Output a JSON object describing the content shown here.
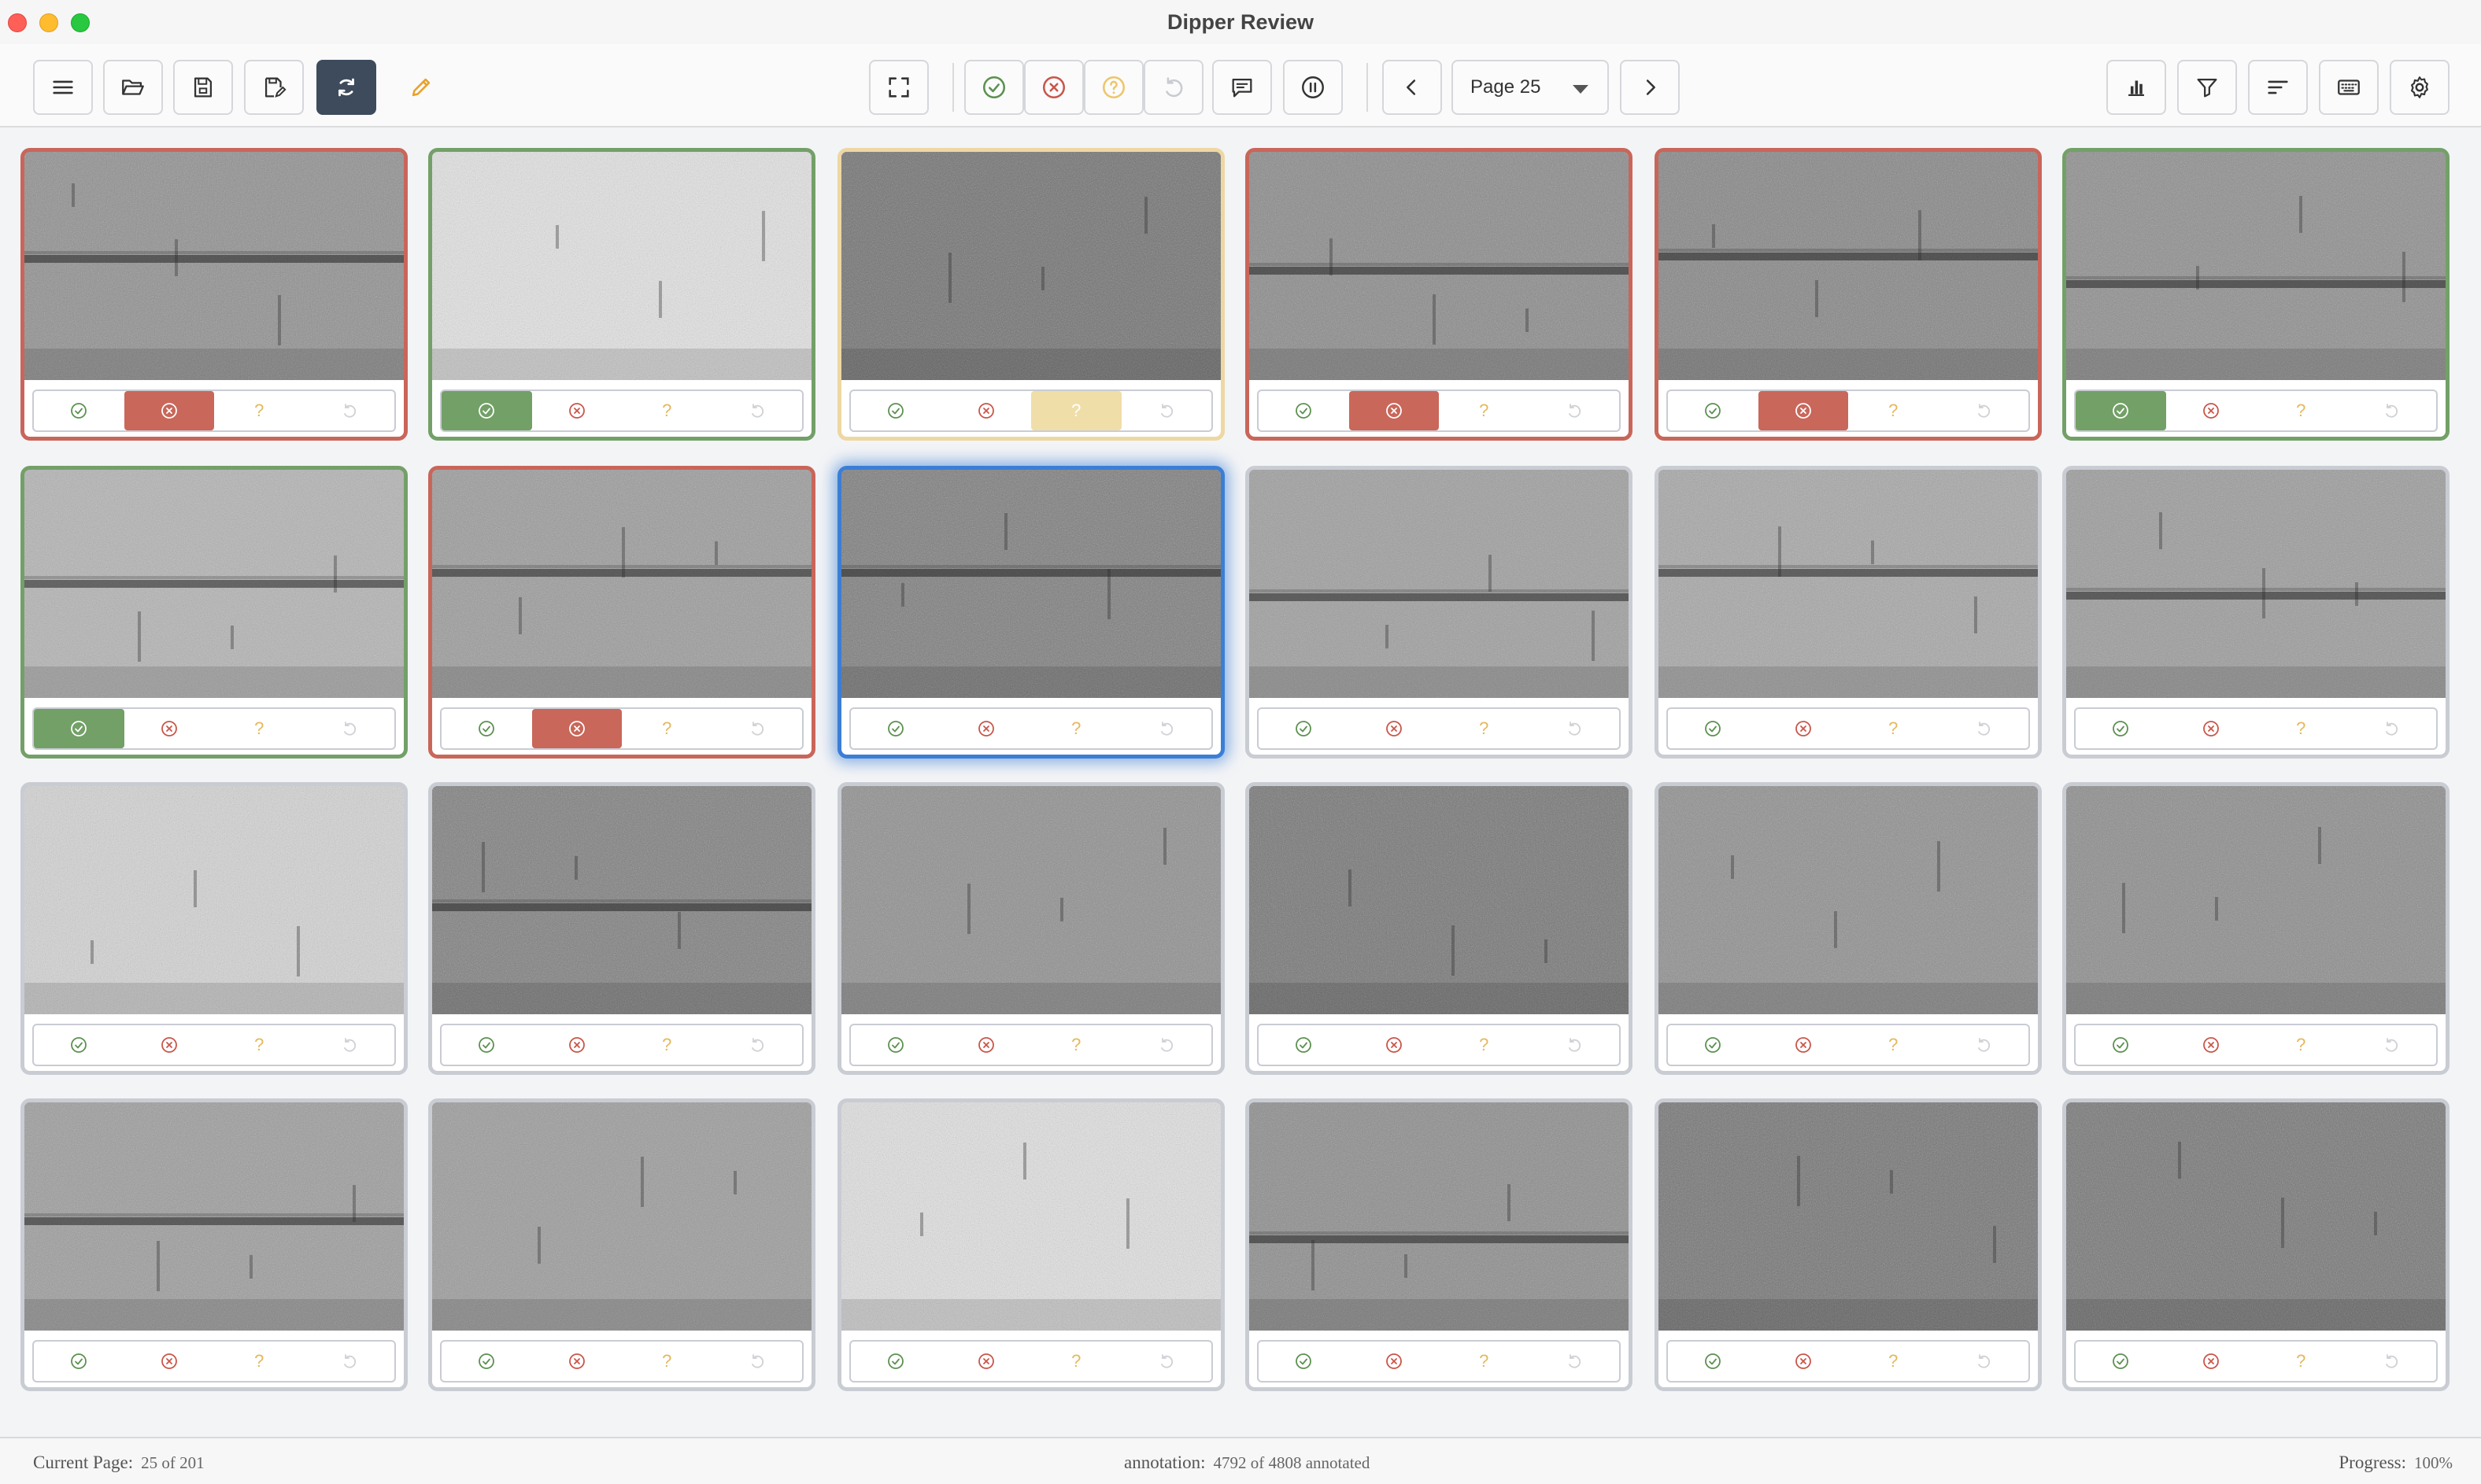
{
  "window": {
    "title": "Dipper Review"
  },
  "toolbar": {
    "left": [
      {
        "name": "menu-button",
        "icon": "menu-icon"
      },
      {
        "name": "open-folder-button",
        "icon": "folder-open-icon"
      },
      {
        "name": "save-button",
        "icon": "save-icon"
      },
      {
        "name": "save-as-button",
        "icon": "save-edit-icon"
      },
      {
        "name": "sync-button",
        "icon": "sync-icon",
        "active": true
      },
      {
        "name": "edit-button",
        "icon": "pencil-icon"
      }
    ],
    "page_select": {
      "label": "Page 25"
    }
  },
  "colors": {
    "yes": "#72a066",
    "no": "#c9675a",
    "maybe": "#f0dea8",
    "focus": "#3b7ed6"
  },
  "grid": {
    "cards": [
      {
        "state": "no",
        "bg": "#8e8e8e",
        "band": 0.47
      },
      {
        "state": "yes",
        "bg": "#e6e6e6",
        "band": -1
      },
      {
        "state": "maybe",
        "bg": "#6e6e6e",
        "band": -1
      },
      {
        "state": "no",
        "bg": "#888888",
        "band": 0.52
      },
      {
        "state": "no",
        "bg": "#838383",
        "band": 0.46
      },
      {
        "state": "yes",
        "bg": "#8c8c8c",
        "band": 0.58
      },
      {
        "state": "yes",
        "bg": "#b4b4b4",
        "band": 0.5
      },
      {
        "state": "no",
        "bg": "#9a9a9a",
        "band": 0.45
      },
      {
        "state": "none",
        "focus": true,
        "bg": "#7a7a7a",
        "band": 0.45
      },
      {
        "state": "none",
        "bg": "#9d9d9d",
        "band": 0.56
      },
      {
        "state": "none",
        "bg": "#a6a6a6",
        "band": 0.45
      },
      {
        "state": "none",
        "bg": "#9a9a9a",
        "band": 0.55
      },
      {
        "state": "none",
        "bg": "#d6d6d6",
        "band": -1
      },
      {
        "state": "none",
        "bg": "#7c7c7c",
        "band": 0.53
      },
      {
        "state": "none",
        "bg": "#8d8d8d",
        "band": -1
      },
      {
        "state": "none",
        "bg": "#727272",
        "band": -1
      },
      {
        "state": "none",
        "bg": "#8d8d8d",
        "band": -1
      },
      {
        "state": "none",
        "bg": "#8a8a8a",
        "band": -1
      },
      {
        "state": "none",
        "bg": "#9b9b9b",
        "band": 0.52
      },
      {
        "state": "none",
        "bg": "#9a9a9a",
        "band": -1
      },
      {
        "state": "none",
        "bg": "#e4e4e4",
        "band": -1
      },
      {
        "state": "none",
        "bg": "#8a8a8a",
        "band": 0.6
      },
      {
        "state": "none",
        "bg": "#717171",
        "band": -1
      },
      {
        "state": "none",
        "bg": "#737373",
        "band": -1
      }
    ],
    "vote_labels": {
      "maybe": "?"
    }
  },
  "status": {
    "current_page_label": "Current Page:",
    "current_page_value": "25 of 201",
    "annotation_label": "annotation:",
    "annotation_value": "4792 of 4808 annotated",
    "progress_label": "Progress:",
    "progress_value": "100%"
  }
}
